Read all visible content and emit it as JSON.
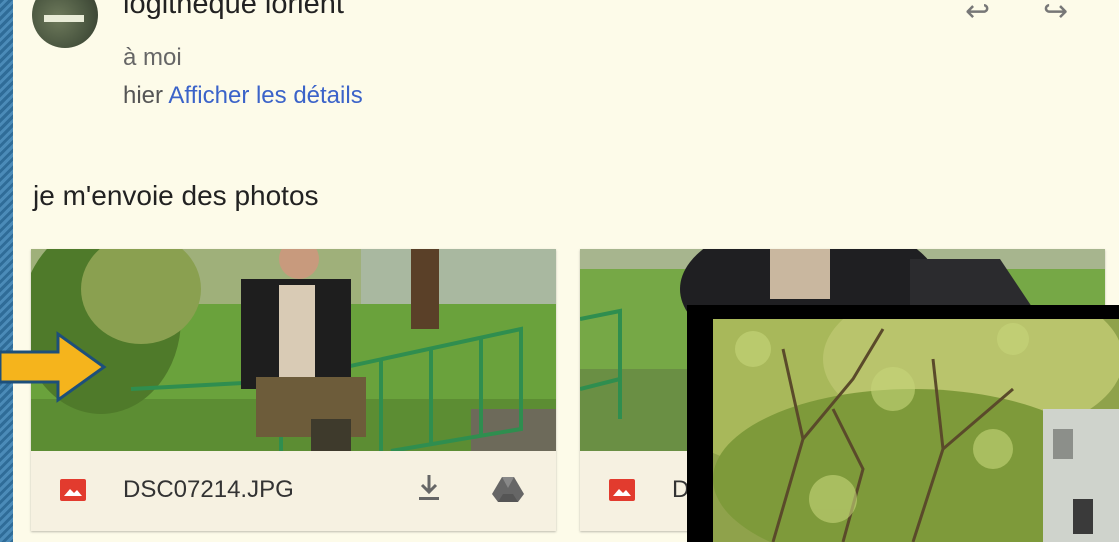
{
  "email": {
    "sender": "logitheque lorient",
    "recipient": "à moi",
    "date": "hier",
    "details_link": "Afficher les détails",
    "body": "je m'envoie des photos"
  },
  "attachments": [
    {
      "filename": "DSC07214.JPG",
      "type_icon": "image-icon",
      "actions": [
        "download-icon",
        "drive-icon"
      ]
    },
    {
      "filename": "D",
      "type_icon": "image-icon"
    }
  ],
  "colors": {
    "frame": "#2f6c98",
    "background": "#fdfbe9",
    "link": "#3b63c9",
    "image_icon": "#e23b2e",
    "arrow": "#f5b41c"
  },
  "icons": [
    "reply-icon",
    "forward-icon",
    "avatar",
    "image-icon",
    "download-icon",
    "drive-icon",
    "arrow-annotation"
  ]
}
